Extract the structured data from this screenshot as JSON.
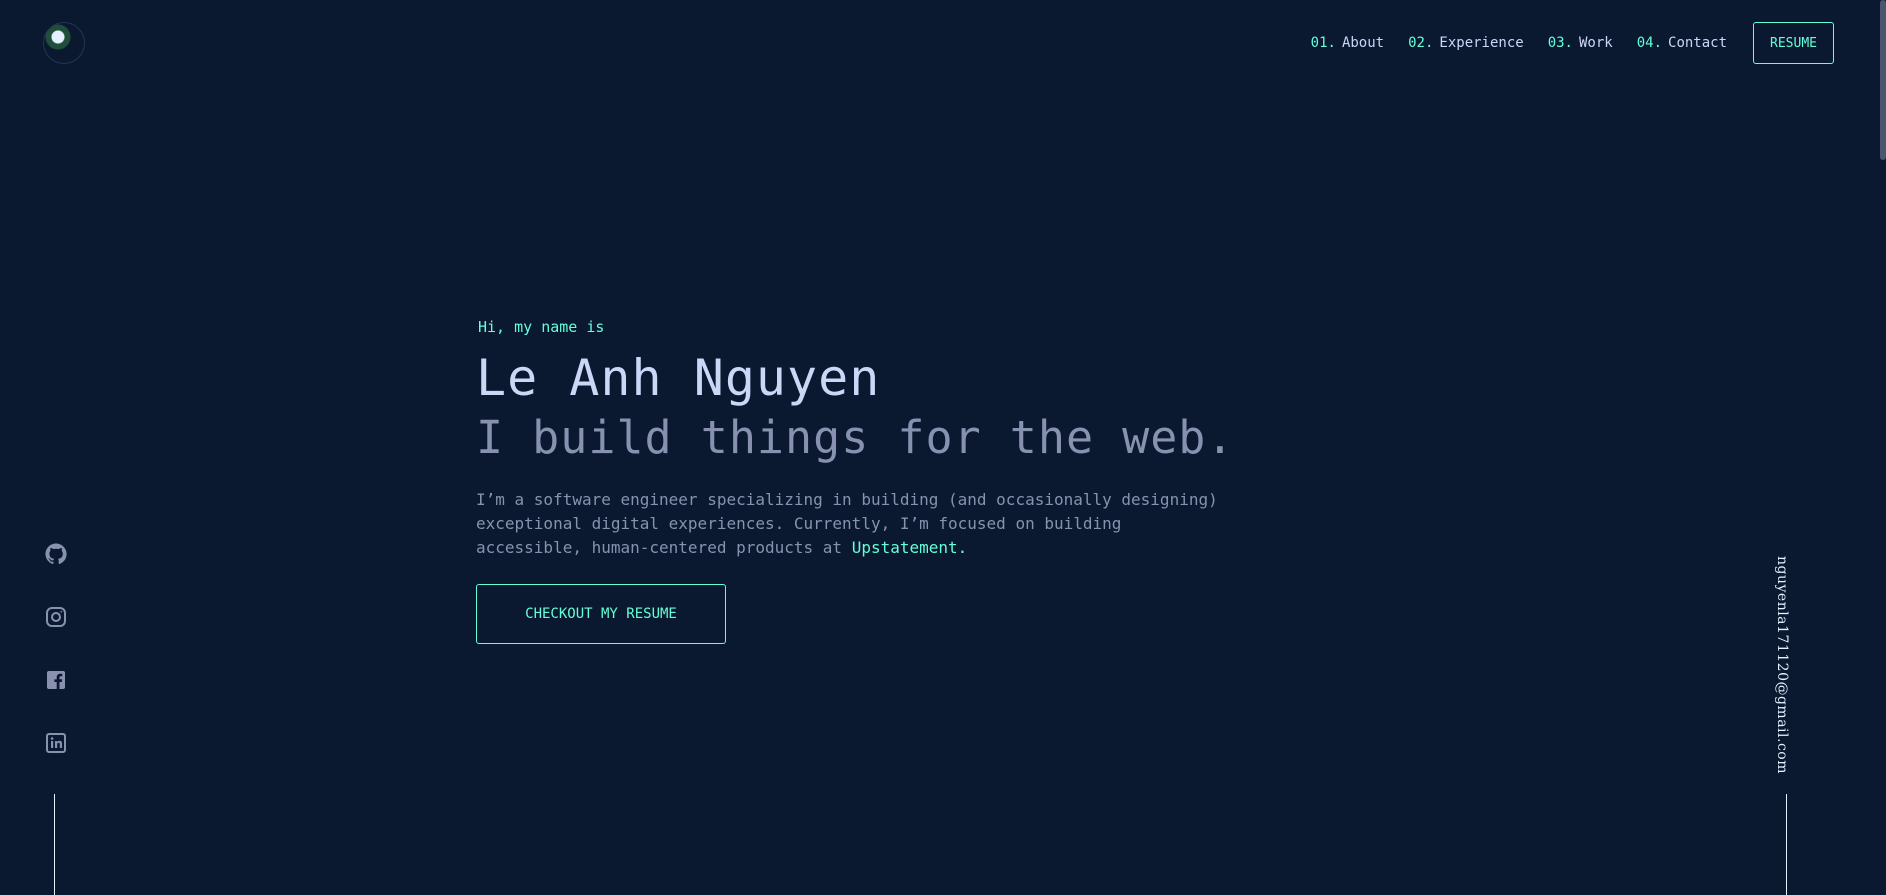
{
  "header": {
    "logo_icon": "avatar-logo",
    "nav": [
      {
        "num": "01.",
        "label": "About"
      },
      {
        "num": "02.",
        "label": "Experience"
      },
      {
        "num": "03.",
        "label": "Work"
      },
      {
        "num": "04.",
        "label": "Contact"
      }
    ],
    "resume_label": "RESUME"
  },
  "hero": {
    "greeting": "Hi, my name is",
    "name": "Le Anh Nguyen",
    "tagline": "I build things for the web.",
    "description_lines": [
      "I’m a software engineer specializing in building (and occasionally designing)",
      "exceptional digital experiences. Currently, I’m focused on building",
      "accessible, human-centered products at "
    ],
    "company_link": "Upstatement.",
    "cta_label": "CHECKOUT MY RESUME"
  },
  "social": {
    "icons": [
      "github-icon",
      "instagram-icon",
      "facebook-icon",
      "linkedin-icon"
    ]
  },
  "email": "nguyenla171120@gmail.com",
  "colors": {
    "background": "#0a192f",
    "accent": "#64ffda",
    "heading": "#ccd6f6",
    "text": "#8892b0"
  }
}
